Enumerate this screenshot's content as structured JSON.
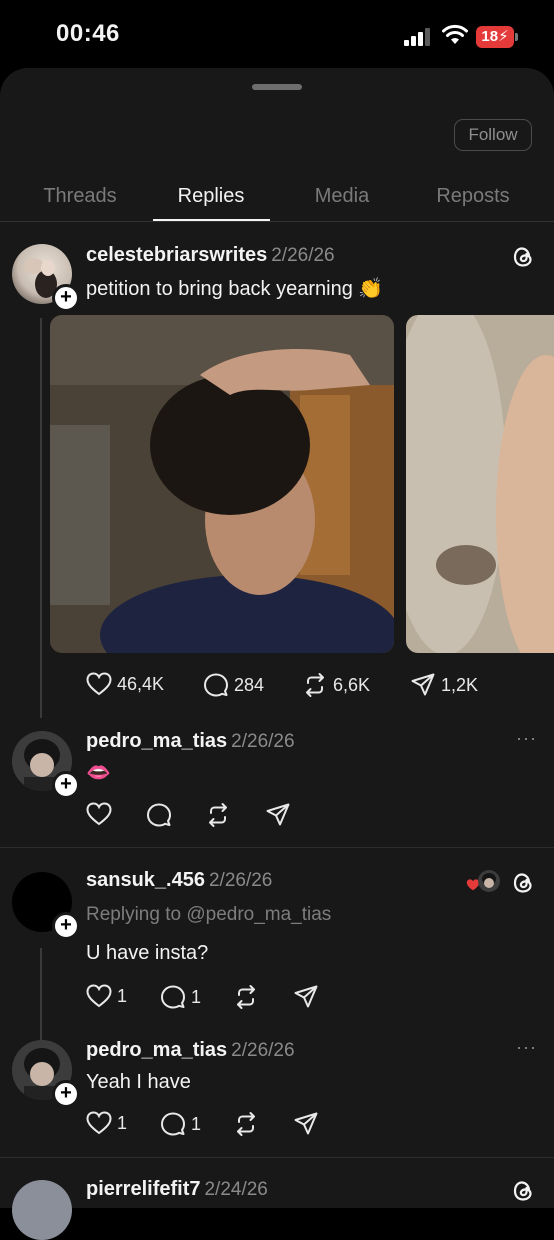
{
  "status": {
    "time": "00:46",
    "battery": "18"
  },
  "profile": {
    "follow_label": "Follow"
  },
  "tabs": [
    "Threads",
    "Replies",
    "Media",
    "Reposts"
  ],
  "posts": [
    {
      "username": "celestebriarswrites",
      "date": "2/26/26",
      "text": "petition to bring back yearning 👏",
      "stats": {
        "likes": "46,4K",
        "replies": "284",
        "reposts": "6,6K",
        "shares": "1,2K"
      }
    },
    {
      "username": "pedro_ma_tias",
      "date": "2/26/26",
      "text": "👄"
    },
    {
      "username": "sansuk_.456",
      "date": "2/26/26",
      "replying_to": "Replying to @pedro_ma_tias",
      "text": "U have insta?",
      "stats": {
        "likes": "1",
        "replies": "1"
      }
    },
    {
      "username": "pedro_ma_tias",
      "date": "2/26/26",
      "text": "Yeah I have",
      "stats": {
        "likes": "1",
        "replies": "1"
      }
    },
    {
      "username": "pierrelifefit7",
      "date": "2/24/26"
    }
  ],
  "colors": {
    "background": "#181818",
    "accent_heart": "#e53a3a"
  },
  "icons": [
    "heart-icon",
    "comment-icon",
    "repost-icon",
    "share-icon",
    "threads-logo-icon",
    "more-icon"
  ]
}
